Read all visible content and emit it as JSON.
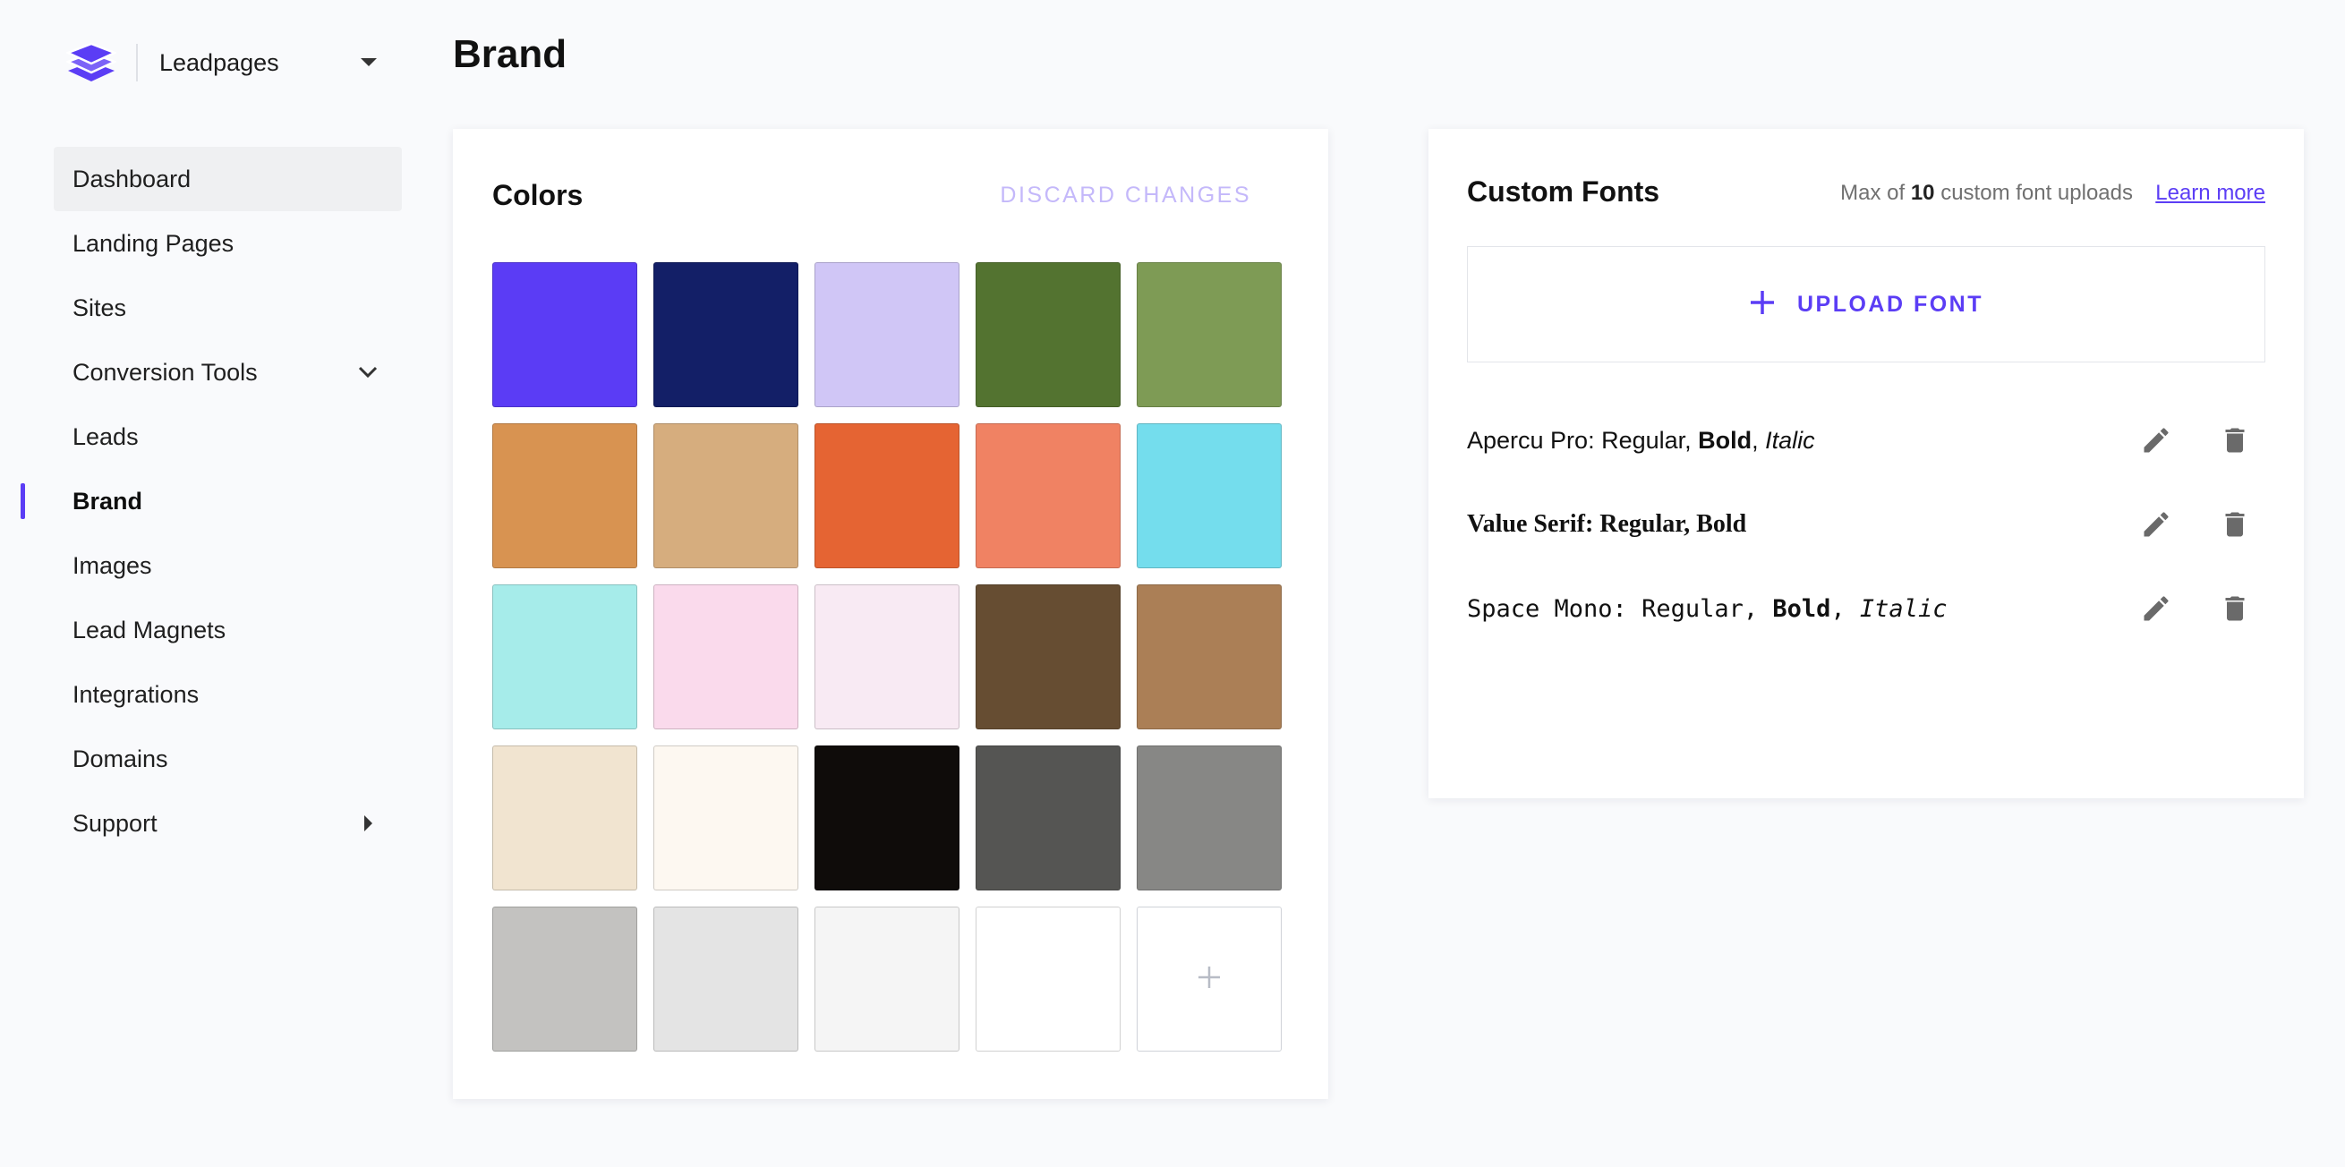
{
  "brand": {
    "name": "Leadpages"
  },
  "nav": {
    "items": [
      {
        "label": "Dashboard"
      },
      {
        "label": "Landing Pages"
      },
      {
        "label": "Sites"
      },
      {
        "label": "Conversion Tools"
      },
      {
        "label": "Leads"
      },
      {
        "label": "Brand"
      },
      {
        "label": "Images"
      },
      {
        "label": "Lead Magnets"
      },
      {
        "label": "Integrations"
      },
      {
        "label": "Domains"
      },
      {
        "label": "Support"
      }
    ]
  },
  "page": {
    "title": "Brand"
  },
  "colors": {
    "title": "Colors",
    "discard_label": "DISCARD CHANGES",
    "swatches": [
      "#5b3cf5",
      "#131f67",
      "#d0c6f6",
      "#537330",
      "#7e9b55",
      "#d89351",
      "#d6ad7e",
      "#e56433",
      "#f08263",
      "#74dded",
      "#a6ecea",
      "#fadaec",
      "#f8eaf3",
      "#664d32",
      "#ab7f56",
      "#f1e4d0",
      "#fdf8f1",
      "#0f0c0a",
      "#555553",
      "#878785",
      "#c3c2c0",
      "#e4e4e4",
      "#f5f5f5",
      "#ffffff"
    ],
    "add_icon": "plus-icon"
  },
  "fonts": {
    "title": "Custom Fonts",
    "note_prefix": "Max of ",
    "note_count": "10",
    "note_suffix": " custom font uploads",
    "learn_more": "Learn more",
    "upload_label": "UPLOAD FONT",
    "rows": [
      {
        "family": "Apercu Pro: Regular, ",
        "bold": "Bold",
        "sep": ", ",
        "italic": "Italic"
      },
      {
        "family": "Value Serif: Regular, Bold"
      },
      {
        "family": "Space Mono: Regular, ",
        "bold": "Bold",
        "sep": ", ",
        "italic": "Italic"
      }
    ]
  },
  "accent_color": "#5b3df5"
}
